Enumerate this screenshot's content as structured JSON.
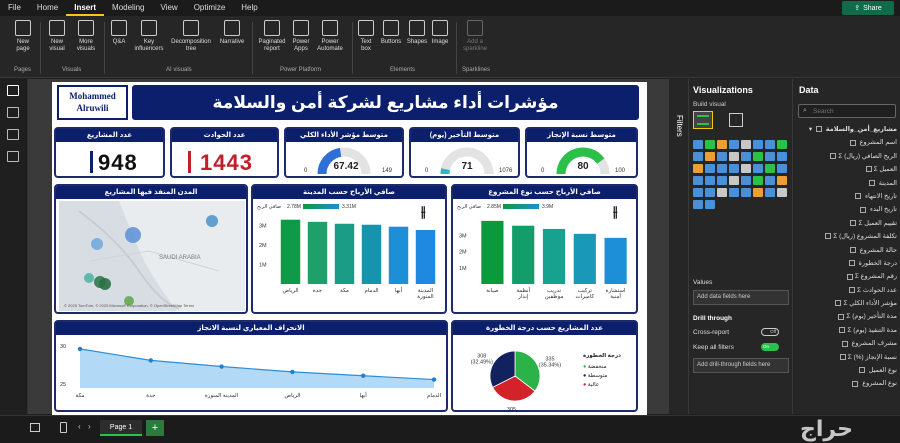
{
  "menu": [
    "File",
    "Home",
    "Insert",
    "Modeling",
    "View",
    "Optimize",
    "Help"
  ],
  "share_label": "Share",
  "ribbon": {
    "buttons": [
      "New page",
      "New visual",
      "More visuals",
      "Q&A",
      "Key influencers",
      "Decomposition tree",
      "Narrative",
      "Paginated report",
      "Power Apps",
      "Power Automate",
      "Text box",
      "Buttons",
      "Shapes",
      "Image",
      "Add a sparkline"
    ],
    "groups": [
      "Pages",
      "Visuals",
      "AI visuals",
      "Power Platform",
      "Elements",
      "Sparklines"
    ]
  },
  "report": {
    "title": "مؤشرات أداء مشاريع لشركة أمن والسلامة",
    "logo_line1": "Mohammed",
    "logo_line2": "Alruwili",
    "kpis": [
      {
        "label": "عدد المشاريع",
        "value": "948",
        "accent": "#0c1f6d"
      },
      {
        "label": "عدد الحوادث",
        "value": "1443",
        "accent": "#c0202a"
      }
    ],
    "gauges": [
      {
        "label": "متوسط مؤشر الأداء الكلي",
        "value": "67.42",
        "min": "0",
        "max": "149",
        "fraction": 0.45,
        "color": "#2f6fd6"
      },
      {
        "label": "متوسط التأخير (يوم)",
        "value": "71",
        "min": "0",
        "max": "1076",
        "fraction": 0.07,
        "color": "#2fb5c8"
      },
      {
        "label": "متوسط نسبة الإنجاز",
        "value": "80",
        "min": "0",
        "max": "100",
        "fraction": 0.8,
        "color": "#2bc04a"
      }
    ],
    "map": {
      "title": "المدن المنفذ فيها المشاريع",
      "region_label": "SAUDI ARABIA",
      "credit": "© 2025 TomTom, © 2025 Microsoft Corporation, © OpenStreetMap Terms"
    },
    "bar_city": {
      "title": "صافي الأرباح حسب المدينة",
      "legend_label": "صافي الربح",
      "legend_min": "2.78M",
      "legend_max": "3.31M"
    },
    "bar_type": {
      "title": "صافي الأرباح حسب نوع المشروع",
      "legend_label": "صافي الربح",
      "legend_min": "2.85M",
      "legend_max": "3.9M"
    },
    "line_card": {
      "title": "الانحراف المعياري لنسبة الانجاز"
    },
    "pie_card": {
      "title": "عدد المشاريع حسب درجة الخطورة",
      "legend_title": "درجة الخطورة",
      "legend": [
        "منخفضة",
        "متوسطة",
        "عالية"
      ]
    }
  },
  "chart_data": [
    {
      "type": "bar",
      "title": "صافي الأرباح حسب المدينة",
      "categories": [
        "الرياض",
        "جدة",
        "مكة",
        "الدمام",
        "أبها",
        "المدينة المنورة"
      ],
      "values": [
        3.31,
        3.2,
        3.1,
        3.05,
        2.95,
        2.78
      ],
      "yticks": [
        "1M",
        "2M",
        "3M"
      ],
      "ylim": [
        0,
        3.5
      ]
    },
    {
      "type": "bar",
      "title": "صافي الأرباح حسب نوع المشروع",
      "categories": [
        "صيانة",
        "أنظمة إنذار",
        "تدريب موظفين",
        "تركيب كاميرات",
        "استشارة أمنية"
      ],
      "values": [
        3.9,
        3.6,
        3.4,
        3.1,
        2.85
      ],
      "yticks": [
        "1M",
        "2M",
        "3M"
      ],
      "ylim": [
        0,
        4.2
      ]
    },
    {
      "type": "area",
      "title": "الانحراف المعياري لنسبة الانجاز",
      "categories": [
        "مكة",
        "جدة",
        "المدينة المنورة",
        "الرياض",
        "أبها",
        "الدمام"
      ],
      "values": [
        29.6,
        28.1,
        27.3,
        26.6,
        26.1,
        25.6
      ],
      "yticks": [
        "25",
        "30"
      ],
      "ylim": [
        24.5,
        30.5
      ]
    },
    {
      "type": "pie",
      "title": "عدد المشاريع حسب درجة الخطورة",
      "slices": [
        {
          "label": "منخفضة",
          "count": 335,
          "percent": "35.34%",
          "color": "#2bb34a"
        },
        {
          "label": "عالية",
          "count": 305,
          "percent": "32.17%",
          "color": "#d4222a"
        },
        {
          "label": "متوسطة",
          "count": 308,
          "percent": "32.49%",
          "color": "#12225e"
        }
      ]
    }
  ],
  "filters_label": "Filters",
  "visualizations": {
    "title": "Visualizations",
    "build_visual": "Build visual",
    "values": "Values",
    "add_fields": "Add data fields here",
    "drill_through": "Drill through",
    "cross_report": "Cross-report",
    "cross_report_state": "Off",
    "keep_filters": "Keep all filters",
    "keep_filters_state": "On",
    "add_drill": "Add drill-through fields here"
  },
  "data_pane": {
    "title": "Data",
    "search_placeholder": "Search",
    "table_name": "مشاريع_أمن_والسلامة",
    "fields": [
      "اسم المشروع",
      "الربح الصافي (ريال)",
      "العميل",
      "المدينة",
      "تاريخ الانتهاء",
      "تاريخ البدء",
      "تقييم العميل",
      "تكلفة المشروع (ريال)",
      "حالة المشروع",
      "درجة الخطورة",
      "رقم المشروع",
      "عدد الحوادث",
      "مؤشر الأداء الكلي",
      "مدة التأخير (يوم)",
      "مدة التنفيذ (يوم)",
      "مشرف المشروع",
      "نسبة الإنجاز (%)",
      "نوع العميل",
      "نوع المشروع"
    ]
  },
  "page_tab": "Page 1",
  "watermark": "حراج"
}
